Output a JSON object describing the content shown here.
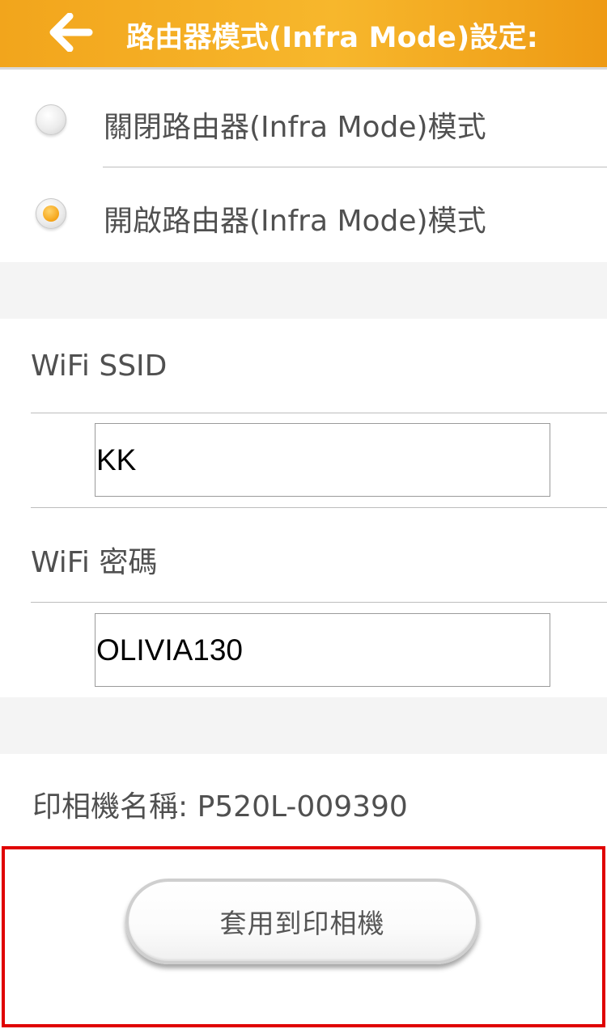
{
  "header": {
    "title": "路由器模式(Infra Mode)設定:",
    "back_icon": "arrow-left-icon",
    "background_color": "#f4ac22"
  },
  "mode_options": [
    {
      "label": "關閉路由器(Infra Mode)模式",
      "selected": false
    },
    {
      "label": "開啟路由器(Infra Mode)模式",
      "selected": true
    }
  ],
  "wifi": {
    "ssid_label": "WiFi SSID",
    "ssid_value": "KK",
    "password_label": "WiFi 密碼",
    "password_value": "OLIVIA130"
  },
  "printer": {
    "name_text": "印相機名稱: P520L-009390"
  },
  "apply_button": {
    "label": "套用到印相機"
  },
  "colors": {
    "accent": "#f5a417",
    "highlight_border": "#e00000",
    "section_gap": "#f4f4f4"
  }
}
